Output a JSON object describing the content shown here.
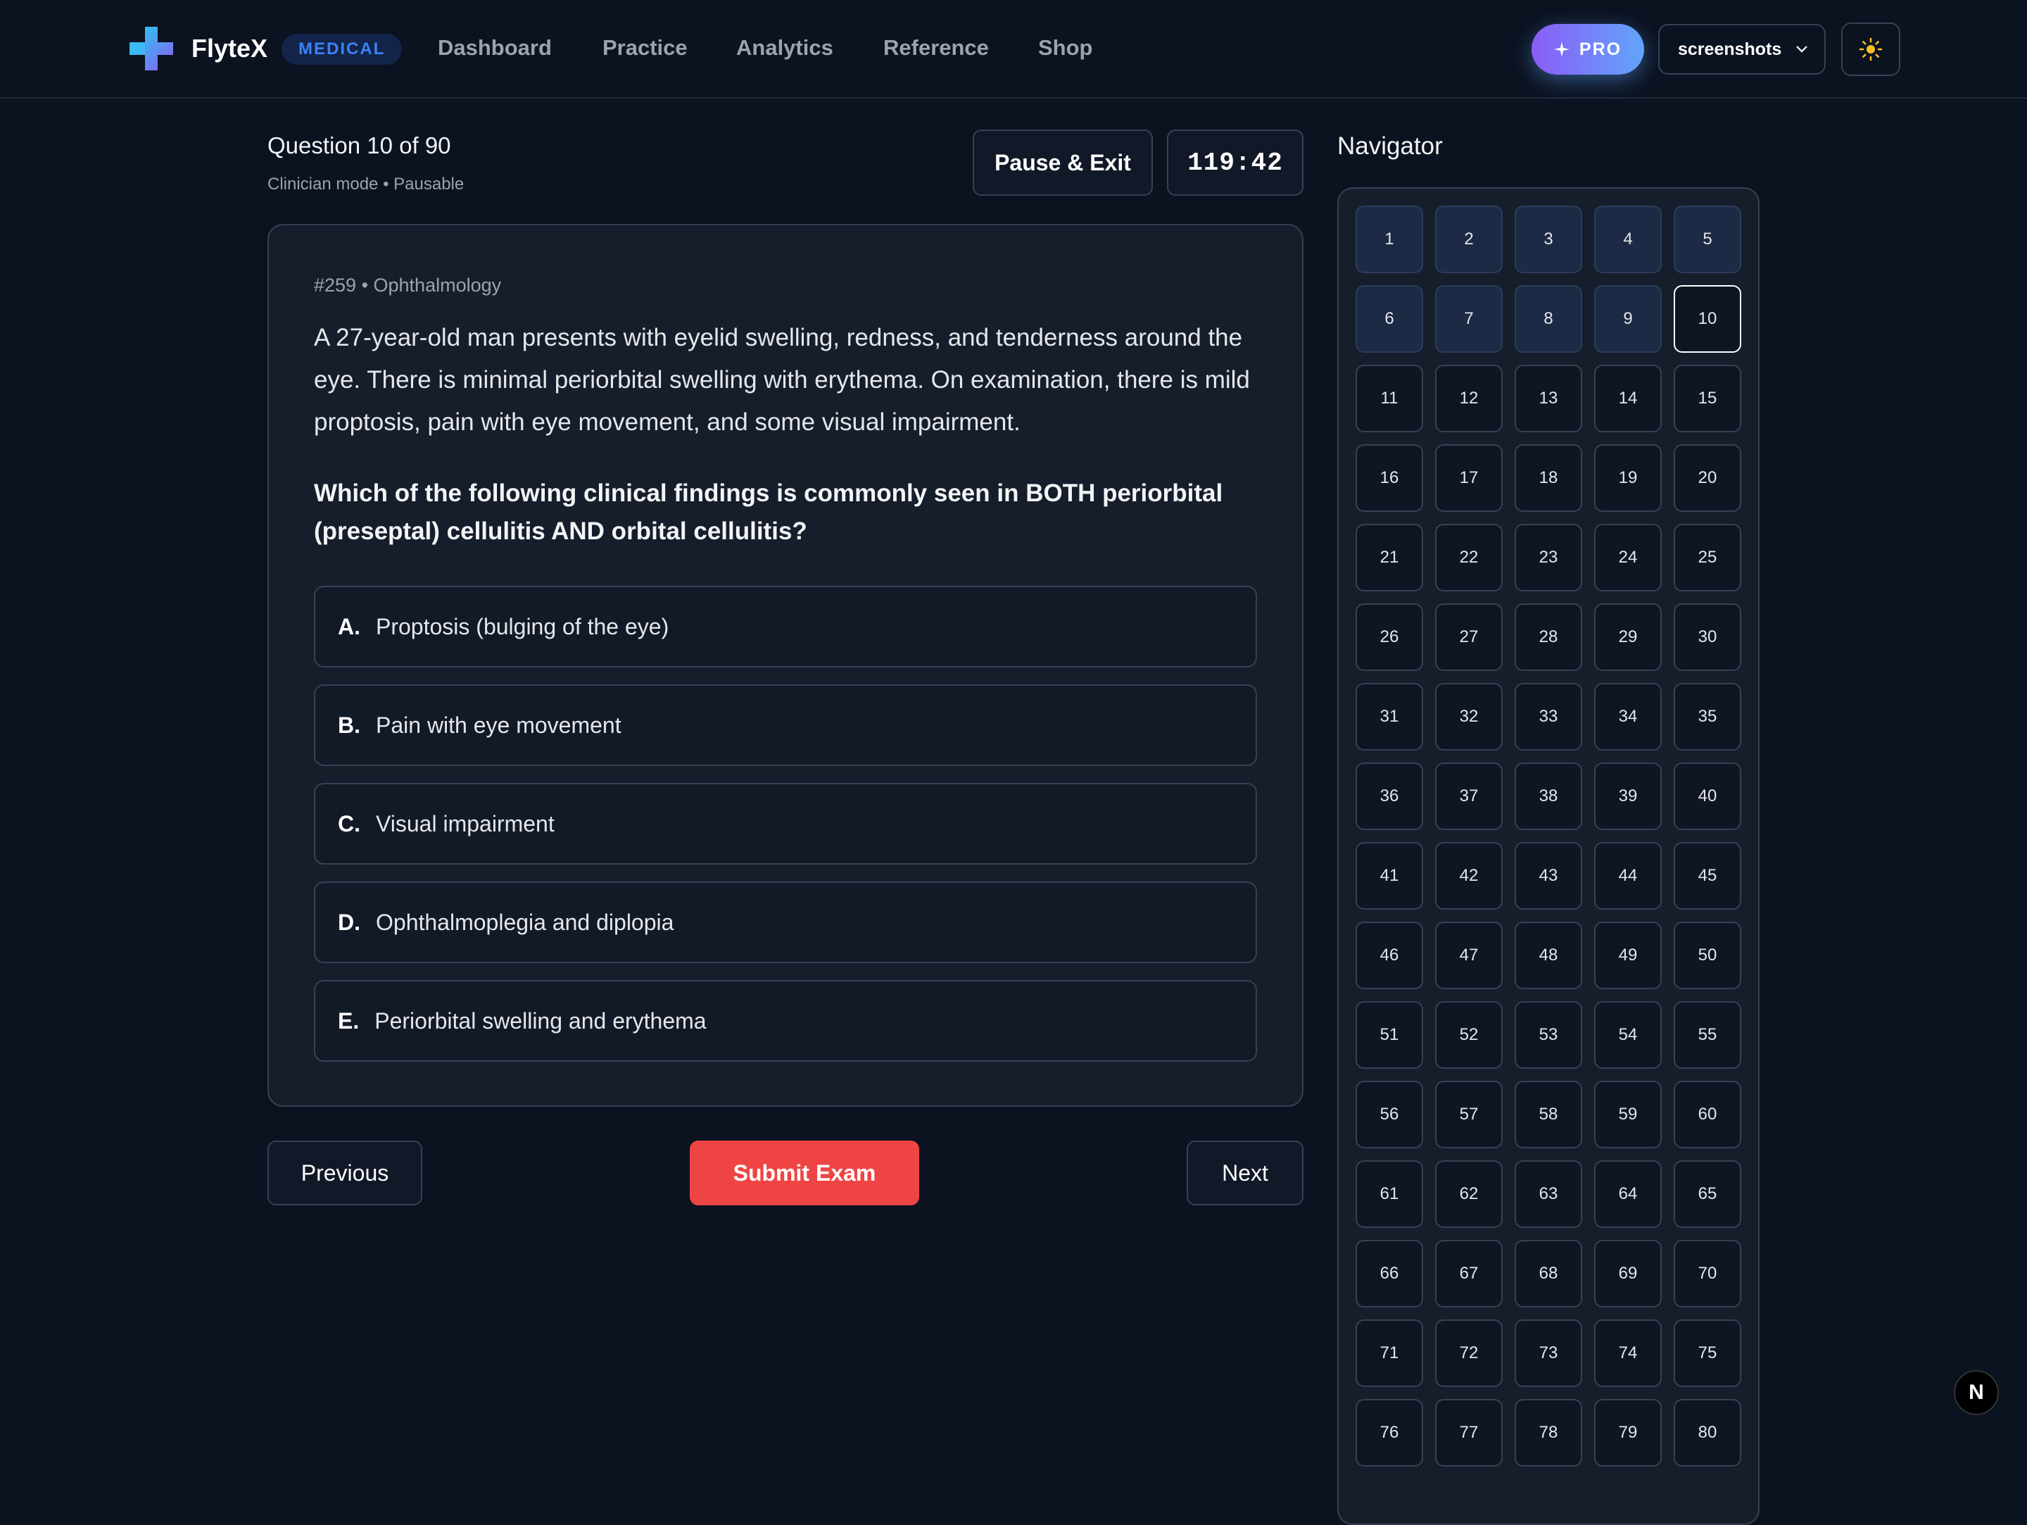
{
  "header": {
    "brand": "FlyteX",
    "badge": "MEDICAL",
    "nav": [
      "Dashboard",
      "Practice",
      "Analytics",
      "Reference",
      "Shop"
    ],
    "pro_label": "PRO",
    "user_label": "screenshots"
  },
  "exam": {
    "title": "Question 10 of 90",
    "subtitle": "Clinician mode • Pausable",
    "pause_label": "Pause & Exit",
    "timer": "119:42"
  },
  "question": {
    "meta": "#259 • Ophthalmology",
    "stem": "A 27-year-old man presents with eyelid swelling, redness, and tenderness around the eye. There is minimal periorbital swelling with erythema. On examination, there is mild proptosis, pain with eye movement, and some visual impairment.",
    "prompt": "Which of the following clinical findings is commonly seen in BOTH periorbital (preseptal) cellulitis AND orbital cellulitis?",
    "options": [
      {
        "letter": "A.",
        "text": "Proptosis (bulging of the eye)"
      },
      {
        "letter": "B.",
        "text": "Pain with eye movement"
      },
      {
        "letter": "C.",
        "text": "Visual impairment"
      },
      {
        "letter": "D.",
        "text": "Ophthalmoplegia and diplopia"
      },
      {
        "letter": "E.",
        "text": "Periorbital swelling and erythema"
      }
    ]
  },
  "footer": {
    "previous_label": "Previous",
    "submit_label": "Submit Exam",
    "next_label": "Next"
  },
  "navigator": {
    "title": "Navigator",
    "items": [
      "1",
      "2",
      "3",
      "4",
      "5",
      "6",
      "7",
      "8",
      "9",
      "10",
      "11",
      "12",
      "13",
      "14",
      "15",
      "16",
      "17",
      "18",
      "19",
      "20",
      "21",
      "22",
      "23",
      "24",
      "25",
      "26",
      "27",
      "28",
      "29",
      "30",
      "31",
      "32",
      "33",
      "34",
      "35",
      "36",
      "37",
      "38",
      "39",
      "40",
      "41",
      "42",
      "43",
      "44",
      "45",
      "46",
      "47",
      "48",
      "49",
      "50",
      "51",
      "52",
      "53",
      "54",
      "55",
      "56",
      "57",
      "58",
      "59",
      "60",
      "61",
      "62",
      "63",
      "64",
      "65",
      "66",
      "67",
      "68",
      "69",
      "70",
      "71",
      "72",
      "73",
      "74",
      "75",
      "76",
      "77",
      "78",
      "79",
      "80"
    ],
    "answered_count": 9,
    "current": 10
  },
  "fab": {
    "label": "N"
  },
  "colors": {
    "background": "#0b1220",
    "accent_blue": "#3b82f6",
    "submit_red": "#ef4444",
    "answered_cell": "#1c2a45"
  },
  "icons": [
    "medical-cross-logo-icon",
    "sparkle-icon",
    "chevron-down-icon",
    "sun-icon"
  ]
}
